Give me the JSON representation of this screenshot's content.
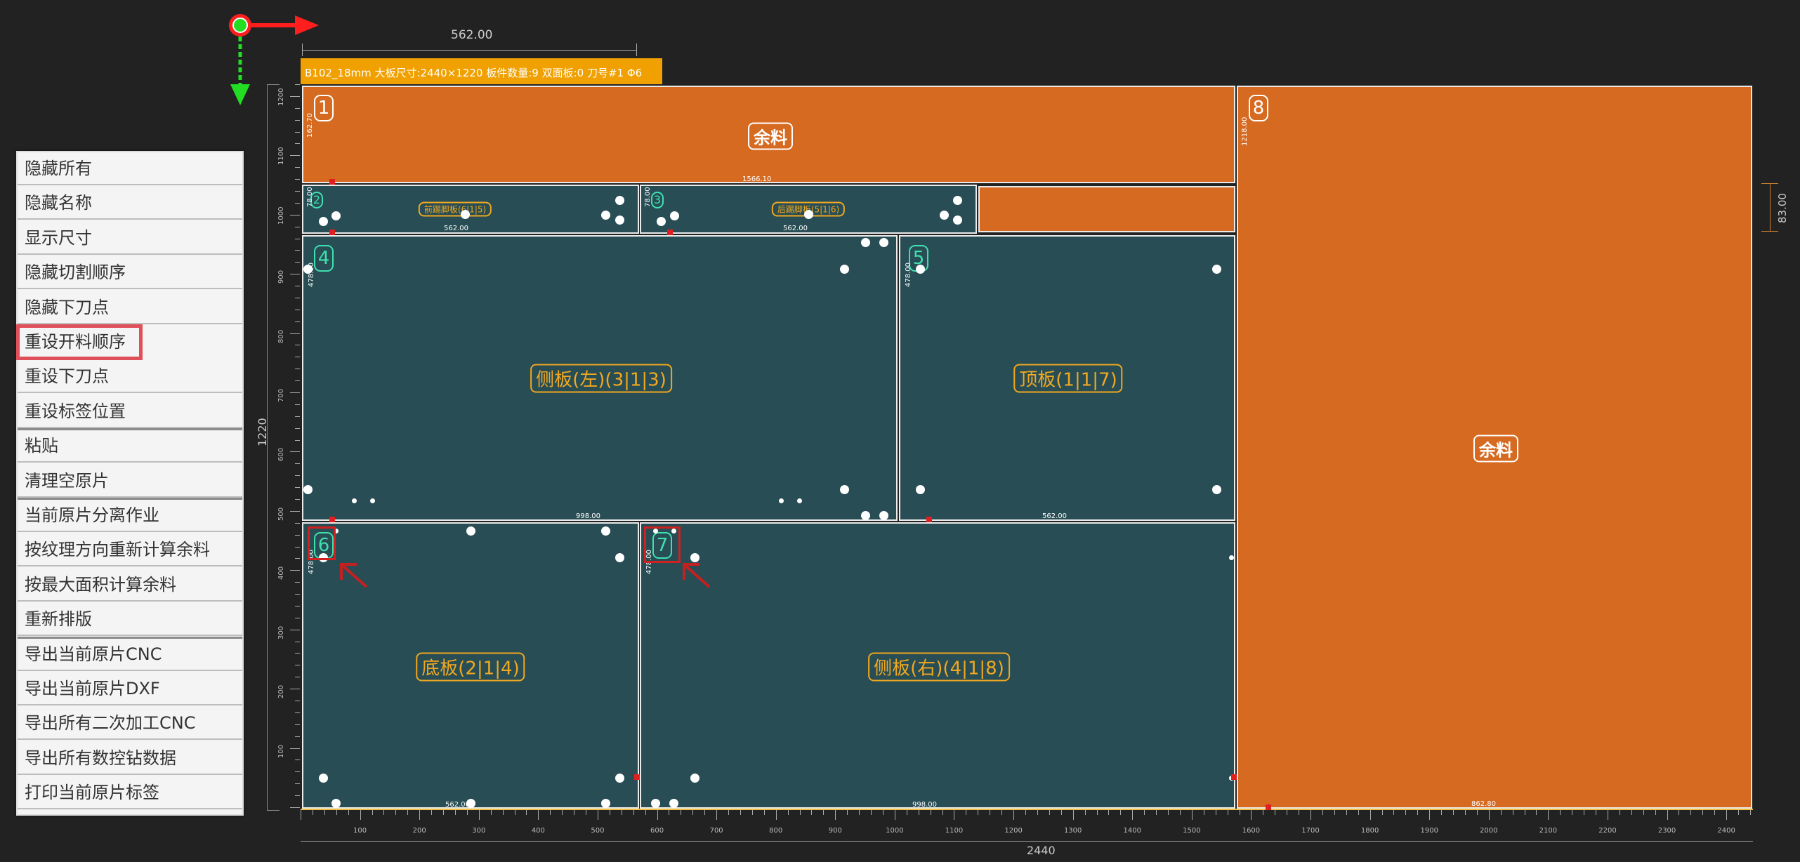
{
  "menu": {
    "items": [
      "隐藏所有",
      "隐藏名称",
      "显示尺寸",
      "隐藏切割顺序",
      "隐藏下刀点",
      "重设开料顺序",
      "重设下刀点",
      "重设标签位置",
      "粘贴",
      "清理空原片",
      "当前原片分离作业",
      "按纹理方向重新计算余料",
      "按最大面积计算余料",
      "重新排版",
      "导出当前原片CNC",
      "导出当前原片DXF",
      "导出所有二次加工CNC",
      "导出所有数控钻数据",
      "打印当前原片标签"
    ],
    "highlighted": "重设开料顺序"
  },
  "board": {
    "info": "B102_18mm 大板尺寸:2440×1220 板件数量:9 双面板:0 刀号#1 Φ6",
    "top_dimension": "562.00",
    "right_dimension": "83.00",
    "width_label": "2440",
    "height_label": "1220",
    "ruler_x_ticks": [
      "100",
      "200",
      "300",
      "400",
      "500",
      "600",
      "700",
      "800",
      "900",
      "1000",
      "1100",
      "1200",
      "1300",
      "1400",
      "1500",
      "1600",
      "1700",
      "1800",
      "1900",
      "2000",
      "2100",
      "2200",
      "2300",
      "2400"
    ],
    "ruler_y_ticks": [
      "100",
      "200",
      "300",
      "400",
      "500",
      "600",
      "700",
      "800",
      "900",
      "1000",
      "1100",
      "1200"
    ]
  },
  "pieces": {
    "p1": {
      "num": "1",
      "label": "余料",
      "dim_w": "1566.10",
      "dim_h": "162.70"
    },
    "p2": {
      "num": "2",
      "label": "前踢脚板(6|1|5)",
      "dim_w": "562.00",
      "dim_h": "78.00"
    },
    "p3": {
      "num": "3",
      "label": "后踢脚板(5|1|6)",
      "dim_w": "562.00",
      "dim_h": "78.00"
    },
    "p4": {
      "num": "4",
      "label": "侧板(左)(3|1|3)",
      "dim_w": "998.00",
      "dim_h": "478.00"
    },
    "p5": {
      "num": "5",
      "label": "顶板(1|1|7)",
      "dim_w": "562.00",
      "dim_h": "478.00"
    },
    "p6": {
      "num": "6",
      "label": "底板(2|1|4)",
      "dim_w": "562.00",
      "dim_h": "478.00"
    },
    "p7": {
      "num": "7",
      "label": "侧板(右)(4|1|8)",
      "dim_w": "998.00",
      "dim_h": "478.00"
    },
    "p8": {
      "num": "8",
      "label": "余料",
      "dim_w": "862.80",
      "dim_h": "1218.00"
    }
  },
  "colors": {
    "background": "#222222",
    "piece": "#284d54",
    "offcut": "#d56a20",
    "label": "#f0a820",
    "number": "#3fe0b0",
    "info_bar": "#f0a000",
    "highlight": "#e0505a"
  },
  "icons": [
    "origin-axis-icon",
    "arrow-right-icon",
    "arrow-down-icon",
    "pointer-arrow-icon"
  ]
}
